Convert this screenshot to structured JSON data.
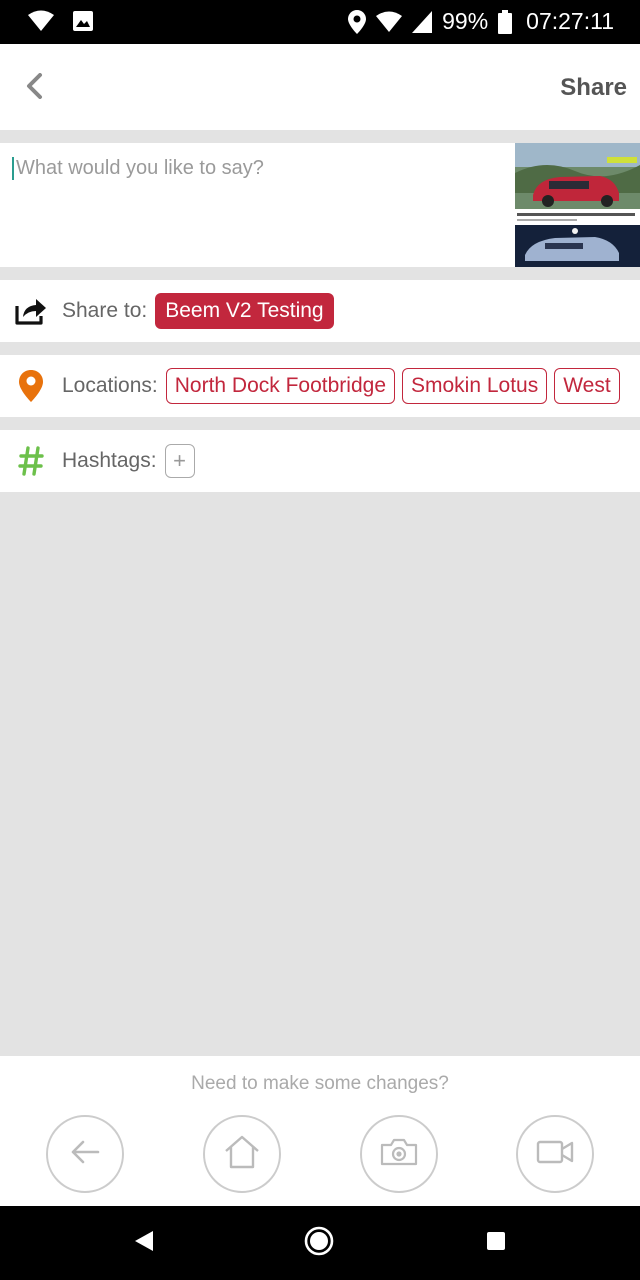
{
  "status_bar": {
    "battery": "99%",
    "time": "07:27:11",
    "icons": [
      "wifi-icon",
      "image-icon",
      "location-icon",
      "wifi-signal-icon",
      "cell-signal-icon",
      "battery-icon"
    ]
  },
  "app_bar": {
    "back_icon": "chevron-left-icon",
    "share_label": "Share"
  },
  "compose": {
    "placeholder": "What would you like to say?",
    "value": ""
  },
  "share_to": {
    "icon": "share-icon",
    "label": "Share to:",
    "target": "Beem V2 Testing"
  },
  "locations": {
    "icon": "location-pin-icon",
    "label": "Locations:",
    "items": [
      "North Dock Footbridge",
      "Smokin Lotus",
      "West"
    ]
  },
  "hashtags": {
    "icon": "hash-icon",
    "label": "Hashtags:",
    "add_label": "+"
  },
  "bottom_panel": {
    "hint": "Need to make some changes?",
    "buttons": [
      "back-arrow-icon",
      "home-icon",
      "camera-icon",
      "video-icon"
    ]
  },
  "colors": {
    "accent": "#c2273d",
    "pin": "#e8720c",
    "hash": "#6cc04a",
    "background": "#e3e3e3"
  }
}
